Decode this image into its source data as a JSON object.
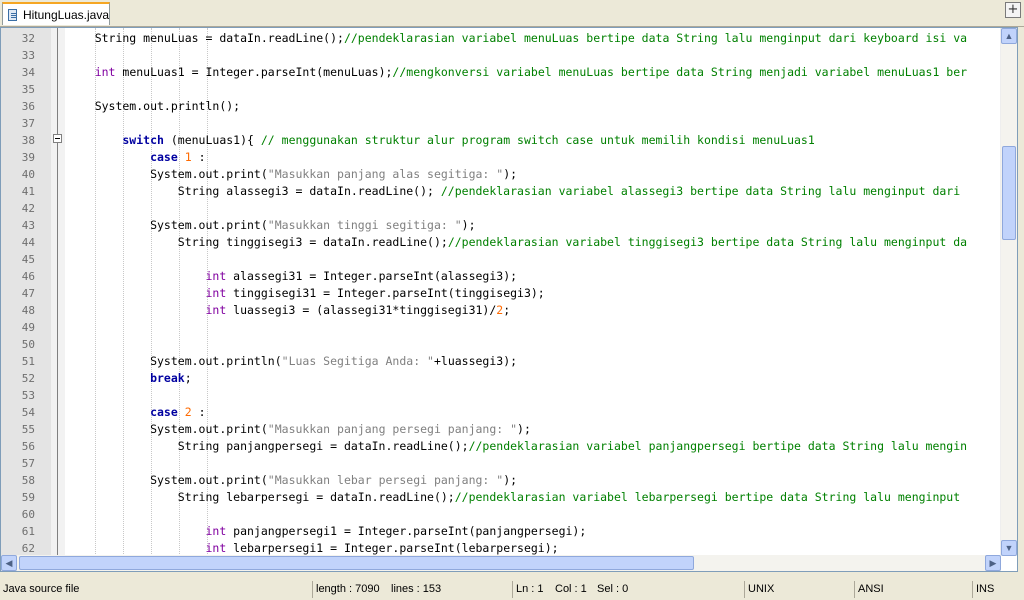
{
  "tab": {
    "filename": "HitungLuas.java",
    "icon": "java-file-icon",
    "close_icon": "new-tab-icon"
  },
  "editor": {
    "lines": [
      {
        "n": "32",
        "tokens": [
          {
            "t": "    String menuLuas = dataIn.readLine();"
          },
          {
            "c": "cm",
            "t": "//pendeklarasian variabel menuLuas bertipe data String lalu menginput dari keyboard isi va"
          }
        ]
      },
      {
        "n": "33",
        "tokens": []
      },
      {
        "n": "34",
        "tokens": [
          {
            "c": "ty",
            "t": "    int"
          },
          {
            "t": " menuLuas1 = Integer.parseInt(menuLuas);"
          },
          {
            "c": "cm",
            "t": "//mengkonversi variabel menuLuas bertipe data String menjadi variabel menuLuas1 ber"
          }
        ]
      },
      {
        "n": "35",
        "tokens": []
      },
      {
        "n": "36",
        "tokens": [
          {
            "t": "    System.out.println();"
          }
        ]
      },
      {
        "n": "37",
        "tokens": []
      },
      {
        "n": "38",
        "tokens": [
          {
            "c": "kw",
            "t": "        switch"
          },
          {
            "t": " (menuLuas1){ "
          },
          {
            "c": "cm",
            "t": "// menggunakan struktur alur program switch case untuk memilih kondisi menuLuas1"
          }
        ]
      },
      {
        "n": "39",
        "tokens": [
          {
            "c": "kw",
            "t": "            case"
          },
          {
            "t": " "
          },
          {
            "c": "nm",
            "t": "1"
          },
          {
            "t": " :"
          }
        ]
      },
      {
        "n": "40",
        "tokens": [
          {
            "t": "            System.out.print("
          },
          {
            "c": "st",
            "t": "\"Masukkan panjang alas segitiga: \""
          },
          {
            "t": ");"
          }
        ]
      },
      {
        "n": "41",
        "tokens": [
          {
            "t": "                String alassegi3 = dataIn.readLine(); "
          },
          {
            "c": "cm",
            "t": "//pendeklarasian variabel alassegi3 bertipe data String lalu menginput dari"
          }
        ]
      },
      {
        "n": "42",
        "tokens": []
      },
      {
        "n": "43",
        "tokens": [
          {
            "t": "            System.out.print("
          },
          {
            "c": "st",
            "t": "\"Masukkan tinggi segitiga: \""
          },
          {
            "t": ");"
          }
        ]
      },
      {
        "n": "44",
        "tokens": [
          {
            "t": "                String tinggisegi3 = dataIn.readLine();"
          },
          {
            "c": "cm",
            "t": "//pendeklarasian variabel tinggisegi3 bertipe data String lalu menginput da"
          }
        ]
      },
      {
        "n": "45",
        "tokens": []
      },
      {
        "n": "46",
        "tokens": [
          {
            "c": "ty",
            "t": "                    int"
          },
          {
            "t": " alassegi31 = Integer.parseInt(alassegi3);"
          }
        ]
      },
      {
        "n": "47",
        "tokens": [
          {
            "c": "ty",
            "t": "                    int"
          },
          {
            "t": " tinggisegi31 = Integer.parseInt(tinggisegi3);"
          }
        ]
      },
      {
        "n": "48",
        "tokens": [
          {
            "c": "ty",
            "t": "                    int"
          },
          {
            "t": " luassegi3 = (alassegi31*tinggisegi31)/"
          },
          {
            "c": "nm",
            "t": "2"
          },
          {
            "t": ";"
          }
        ]
      },
      {
        "n": "49",
        "tokens": []
      },
      {
        "n": "50",
        "tokens": []
      },
      {
        "n": "51",
        "tokens": [
          {
            "t": "            System.out.println("
          },
          {
            "c": "st",
            "t": "\"Luas Segitiga Anda: \""
          },
          {
            "t": "+luassegi3);"
          }
        ]
      },
      {
        "n": "52",
        "tokens": [
          {
            "c": "kw",
            "t": "            break"
          },
          {
            "t": ";"
          }
        ]
      },
      {
        "n": "53",
        "tokens": []
      },
      {
        "n": "54",
        "tokens": [
          {
            "c": "kw",
            "t": "            case"
          },
          {
            "t": " "
          },
          {
            "c": "nm",
            "t": "2"
          },
          {
            "t": " :"
          }
        ]
      },
      {
        "n": "55",
        "tokens": [
          {
            "t": "            System.out.print("
          },
          {
            "c": "st",
            "t": "\"Masukkan panjang persegi panjang: \""
          },
          {
            "t": ");"
          }
        ]
      },
      {
        "n": "56",
        "tokens": [
          {
            "t": "                String panjangpersegi = dataIn.readLine();"
          },
          {
            "c": "cm",
            "t": "//pendeklarasian variabel panjangpersegi bertipe data String lalu mengin"
          }
        ]
      },
      {
        "n": "57",
        "tokens": []
      },
      {
        "n": "58",
        "tokens": [
          {
            "t": "            System.out.print("
          },
          {
            "c": "st",
            "t": "\"Masukkan lebar persegi panjang: \""
          },
          {
            "t": ");"
          }
        ]
      },
      {
        "n": "59",
        "tokens": [
          {
            "t": "                String lebarpersegi = dataIn.readLine();"
          },
          {
            "c": "cm",
            "t": "//pendeklarasian variabel lebarpersegi bertipe data String lalu menginput"
          }
        ]
      },
      {
        "n": "60",
        "tokens": []
      },
      {
        "n": "61",
        "tokens": [
          {
            "c": "ty",
            "t": "                    int"
          },
          {
            "t": " panjangpersegi1 = Integer.parseInt(panjangpersegi);"
          }
        ]
      },
      {
        "n": "62",
        "tokens": [
          {
            "c": "ty",
            "t": "                    int"
          },
          {
            "t": " lebarpersegi1 = Integer.parseInt(lebarpersegi);"
          }
        ]
      }
    ]
  },
  "status": {
    "file_type": "Java source file",
    "length": "length : 7090",
    "lines": "lines : 153",
    "ln": "Ln : 1",
    "col": "Col : 1",
    "sel": "Sel : 0",
    "eol": "UNIX",
    "encoding": "ANSI",
    "mode": "INS"
  },
  "colors": {
    "keyword": "#0000a0",
    "type": "#8000a0",
    "comment": "#008000",
    "string": "#808080",
    "number": "#ff6a00",
    "active_tab_accent": "#f5a623"
  }
}
